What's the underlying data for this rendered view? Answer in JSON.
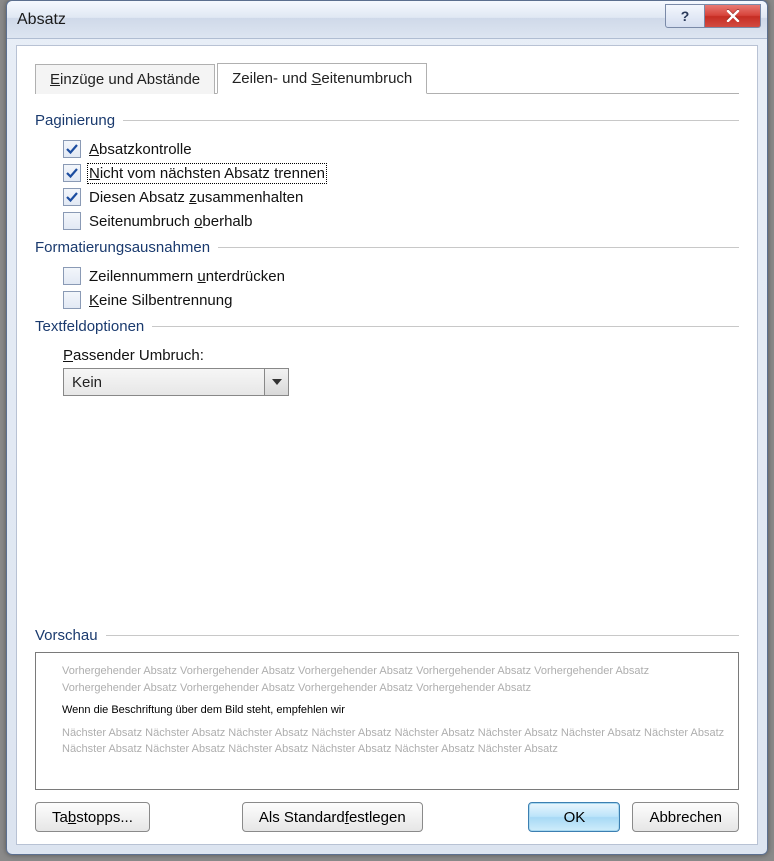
{
  "window": {
    "title": "Absatz"
  },
  "tabs": {
    "indent": {
      "pre": "",
      "u": "E",
      "post": "inzüge und Abstände"
    },
    "breaks": {
      "pre": "Zeilen- und ",
      "u": "S",
      "post": "eitenumbruch"
    }
  },
  "groups": {
    "paginierung": "Paginierung",
    "formatierung": "Formatierungsausnahmen",
    "textfeld": "Textfeldoptionen",
    "vorschau": "Vorschau"
  },
  "checks": {
    "absatzkontrolle": {
      "checked": true,
      "pre": "",
      "u": "A",
      "post": "bsatzkontrolle"
    },
    "nicht_trennen": {
      "checked": true,
      "pre": "",
      "u": "N",
      "post": "icht vom nächsten Absatz trennen"
    },
    "zusammenhalten": {
      "checked": true,
      "pre": "Diesen Absatz ",
      "u": "z",
      "post": "usammenhalten"
    },
    "seitenumbruch": {
      "checked": false,
      "pre": "Seitenumbruch ",
      "u": "o",
      "post": "berhalb"
    },
    "zeilennummern": {
      "checked": false,
      "pre": "Zeilennummern ",
      "u": "u",
      "post": "nterdrücken"
    },
    "silbentrennung": {
      "checked": false,
      "pre": "",
      "u": "K",
      "post": "eine Silbentrennung"
    }
  },
  "textfield": {
    "label": {
      "pre": "",
      "u": "P",
      "post": "assender Umbruch:"
    },
    "value": "Kein"
  },
  "preview": {
    "prev": "Vorhergehender Absatz Vorhergehender Absatz Vorhergehender Absatz Vorhergehender Absatz Vorhergehender Absatz Vorhergehender Absatz Vorhergehender Absatz Vorhergehender Absatz Vorhergehender Absatz",
    "current": "Wenn die Beschriftung über dem Bild steht, empfehlen wir",
    "next": "Nächster Absatz Nächster Absatz Nächster Absatz Nächster Absatz Nächster Absatz Nächster Absatz Nächster Absatz Nächster Absatz Nächster Absatz Nächster Absatz Nächster Absatz Nächster Absatz Nächster Absatz Nächster Absatz"
  },
  "buttons": {
    "tabstops": {
      "pre": "Ta",
      "u": "b",
      "post": "stopps..."
    },
    "standard": {
      "pre": "Als Standard ",
      "u": "f",
      "post": "estlegen"
    },
    "ok": "OK",
    "cancel": "Abbrechen"
  }
}
